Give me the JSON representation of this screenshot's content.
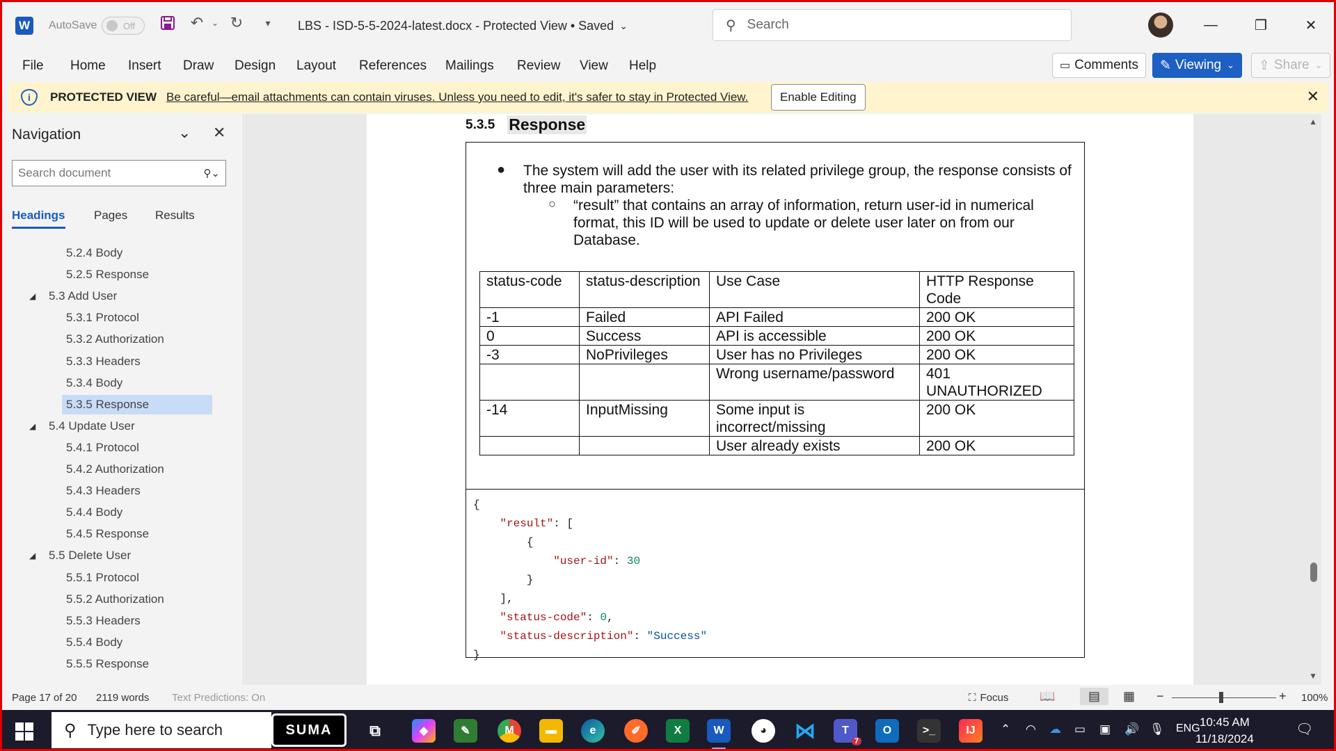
{
  "titlebar": {
    "app_icon": "W",
    "autosave_label": "AutoSave",
    "autosave_state": "Off",
    "doc_title": "LBS - ISD-5-5-2024-latest.docx  -  Protected View • Saved",
    "search_placeholder": "Search"
  },
  "menu": {
    "items": [
      "File",
      "Home",
      "Insert",
      "Draw",
      "Design",
      "Layout",
      "References",
      "Mailings",
      "Review",
      "View",
      "Help"
    ],
    "comments": "Comments",
    "viewing": "Viewing",
    "share": "Share"
  },
  "protected": {
    "title": "PROTECTED VIEW",
    "message": "Be careful—email attachments can contain viruses. Unless you need to edit, it's safer to stay in Protected View.",
    "button": "Enable Editing"
  },
  "nav": {
    "title": "Navigation",
    "search_placeholder": "Search document",
    "tabs": [
      "Headings",
      "Pages",
      "Results"
    ],
    "items": [
      {
        "label": "5.2.4 Body",
        "level": 2
      },
      {
        "label": "5.2.5 Response",
        "level": 2
      },
      {
        "label": "5.3 Add User",
        "level": 1
      },
      {
        "label": "5.3.1 Protocol",
        "level": 2
      },
      {
        "label": "5.3.2 Authorization",
        "level": 2
      },
      {
        "label": "5.3.3 Headers",
        "level": 2
      },
      {
        "label": "5.3.4 Body",
        "level": 2
      },
      {
        "label": "5.3.5 Response",
        "level": 2,
        "selected": true
      },
      {
        "label": "5.4 Update User",
        "level": 1
      },
      {
        "label": "5.4.1 Protocol",
        "level": 2
      },
      {
        "label": "5.4.2 Authorization",
        "level": 2
      },
      {
        "label": "5.4.3 Headers",
        "level": 2
      },
      {
        "label": "5.4.4 Body",
        "level": 2
      },
      {
        "label": "5.4.5 Response",
        "level": 2
      },
      {
        "label": "5.5 Delete User",
        "level": 1
      },
      {
        "label": "5.5.1 Protocol",
        "level": 2
      },
      {
        "label": "5.5.2 Authorization",
        "level": 2
      },
      {
        "label": "5.5.3 Headers",
        "level": 2
      },
      {
        "label": "5.5.4 Body",
        "level": 2
      },
      {
        "label": "5.5.5 Response",
        "level": 2
      }
    ]
  },
  "document": {
    "heading_number": "5.3.5",
    "heading_text": "Response",
    "bullet1": "The system will add the user with its related privilege group, the response consists of three main parameters:",
    "bullet2": "“result” that contains an array of information, return user-id in numerical format, this ID will be used to update or delete user later on from our Database.",
    "table": {
      "headers": [
        "status-code",
        "status-description",
        "Use Case",
        "HTTP Response Code"
      ],
      "rows": [
        [
          "-1",
          "Failed",
          "API Failed",
          "200 OK"
        ],
        [
          "0",
          "Success",
          "API is accessible",
          "200 OK"
        ],
        [
          "-3",
          "NoPrivileges",
          "User has no Privileges",
          "200 OK"
        ],
        [
          "",
          "",
          "Wrong username/password",
          "401 UNAUTHORIZED"
        ],
        [
          "-14",
          "InputMissing",
          "Some input is incorrect/missing",
          "200 OK"
        ],
        [
          "",
          "",
          "User already exists",
          "200 OK"
        ]
      ]
    },
    "json": {
      "key_result": "\"result\"",
      "key_user_id": "\"user-id\"",
      "user_id": "30",
      "key_status_code": "\"status-code\"",
      "status_code": "0",
      "key_status_desc": "\"status-description\"",
      "status_desc": "\"Success\""
    }
  },
  "status": {
    "page": "Page 17 of 20",
    "words": "2119 words",
    "predictions": "Text Predictions: On",
    "focus": "Focus",
    "zoom": "100%"
  },
  "taskbar": {
    "search_placeholder": "Type here to search",
    "suma_label": "SUMA",
    "teams_badge": "7",
    "lang": "ENG",
    "time": "10:45 AM",
    "date": "11/18/2024"
  },
  "colors": {
    "accent": "#185abd",
    "protected_bg": "#fff4ce",
    "selected_nav": "#c9dcf7",
    "frame": "#e00000"
  }
}
